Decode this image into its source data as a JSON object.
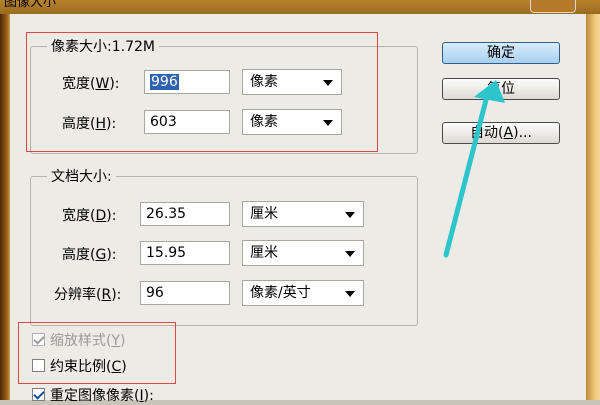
{
  "window": {
    "title": "图像大小"
  },
  "pixel_dimensions": {
    "legend_label": "像素大小:",
    "legend_size": "1.72M",
    "width": {
      "label": "宽度(",
      "key": "W",
      "suffix": "):",
      "value": "996",
      "unit": "像素"
    },
    "height": {
      "label": "高度(",
      "key": "H",
      "suffix": "):",
      "value": "603",
      "unit": "像素"
    }
  },
  "document_size": {
    "legend": "文档大小:",
    "width": {
      "label": "宽度(",
      "key": "D",
      "suffix": "):",
      "value": "26.35",
      "unit": "厘米"
    },
    "height": {
      "label": "高度(",
      "key": "G",
      "suffix": "):",
      "value": "15.95",
      "unit": "厘米"
    },
    "resolution": {
      "label": "分辨率(",
      "key": "R",
      "suffix": "):",
      "value": "96",
      "unit": "像素/英寸"
    }
  },
  "buttons": {
    "ok": "确定",
    "reset": "复位",
    "auto_label": "自动(",
    "auto_key": "A",
    "auto_suffix": ")..."
  },
  "options": {
    "scale_styles": {
      "label": "缩放样式(",
      "key": "Y",
      "suffix": ")",
      "checked": true,
      "disabled": true
    },
    "constrain": {
      "label": "约束比例(",
      "key": "C",
      "suffix": ")",
      "checked": false
    },
    "resample": {
      "label": "重定图像像素(",
      "key": "I",
      "suffix": "):",
      "checked": true
    }
  },
  "colors": {
    "annotation_box": "#e04848",
    "annotation_arrow": "#2ec4cc",
    "default_button": "#a9cfef"
  }
}
